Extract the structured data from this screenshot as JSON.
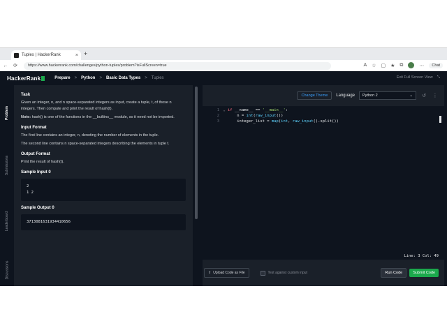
{
  "browser": {
    "tab_title": "Tuples | HackerRank",
    "tab_close": "×",
    "new_tab": "+",
    "back": "←",
    "refresh": "⟳",
    "url": "https://www.hackerrank.com/challenges/python-tuples/problem?isFullScreen=true",
    "chat_label": "Chat"
  },
  "header": {
    "logo": "HackerRank",
    "crumbs": [
      "Prepare",
      "Python",
      "Basic Data Types",
      "Tuples"
    ],
    "sep": ">",
    "exit_full_screen": "Exit Full Screen View"
  },
  "vtabs": [
    "Problem",
    "Submissions",
    "Leaderboard",
    "Discussions"
  ],
  "problem": {
    "task_heading": "Task",
    "task_text": "Given an integer, n, and n space-separated integers as input, create a tuple, t, of those n integers. Then compute and print the result of hash(t).",
    "note_label": "Note:",
    "note_text": "hash() is one of the functions in the __builtins__ module, so it need not be imported.",
    "input_heading": "Input Format",
    "input_line1": "The first line contains an integer, n, denoting the number of elements in the tuple.",
    "input_line2": "The second line contains n space-separated integers describing the elements in tuple t.",
    "output_heading": "Output Format",
    "output_text": "Print the result of hash(t).",
    "sample_input_heading": "Sample Input 0",
    "sample_input_line1": "2",
    "sample_input_line2": "1 2",
    "sample_output_heading": "Sample Output 0",
    "sample_output": "3713081631934410656"
  },
  "editor": {
    "change_theme": "Change Theme",
    "language_label": "Language",
    "language_value": "Python 2",
    "lines": [
      {
        "n": "1",
        "fold": "⌄"
      },
      {
        "n": "2",
        "fold": ""
      },
      {
        "n": "3",
        "fold": ""
      }
    ],
    "status": "Line: 3  Col: 49",
    "upload_label": "Upload Code as File",
    "custom_input_label": "Test against custom input",
    "run_label": "Run Code",
    "submit_label": "Submit Code"
  },
  "colors": {
    "bg": "#0e141e",
    "panel": "#1a2029",
    "accent_green": "#1ba94c",
    "link_blue": "#39a0ff"
  }
}
